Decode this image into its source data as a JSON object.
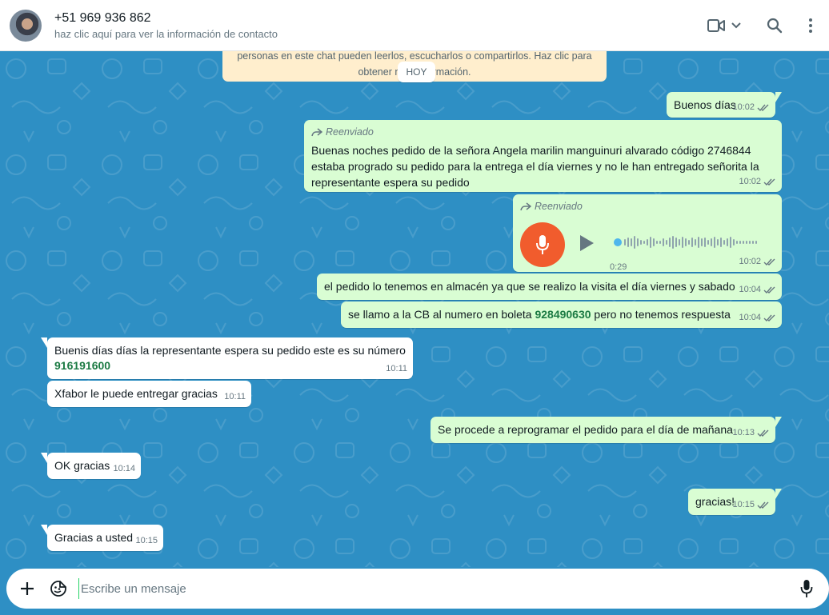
{
  "header": {
    "contact_name": "+51 969 936 862",
    "contact_subtitle": "haz clic aquí para ver la información de contacto"
  },
  "notice": {
    "line1": "personas en este chat pueden leerlos, escucharlos o compartirlos. Haz clic para",
    "line2": "obtener más información."
  },
  "date_divider": "HOY",
  "messages": [
    {
      "dir": "out",
      "text": "Buenos días",
      "time": "10:02"
    },
    {
      "dir": "out",
      "forwarded": "Reenviado",
      "text": "Buenas noches pedido de la señora Angela  marilin manguinuri alvarado  código 2746844 estaba progrado su pedido para la entrega el día viernes y no le han entregado señorita la representante espera su pedido",
      "time": "10:02"
    },
    {
      "dir": "out",
      "forwarded": "Reenviado",
      "type": "audio",
      "duration": "0:29",
      "time": "10:02"
    },
    {
      "dir": "out",
      "text": "el pedido lo tenemos en almacén ya que se realizo la visita el día viernes y sabado",
      "time": "10:04"
    },
    {
      "dir": "out",
      "text_before": "se llamo a la CB al numero en boleta ",
      "phone": "928490630",
      "text_after": " pero no tenemos respuesta",
      "time": "10:04"
    },
    {
      "dir": "in",
      "text": "Buenis días días la representante  espera su pedido este es su número",
      "phone": "916191600",
      "time": "10:11"
    },
    {
      "dir": "in",
      "text": "Xfabor le puede entregar gracias",
      "time": "10:11"
    },
    {
      "dir": "out",
      "text": "Se procede a reprogramar el pedido para el día de mañana",
      "time": "10:13"
    },
    {
      "dir": "in",
      "text": "OK gracias",
      "time": "10:14"
    },
    {
      "dir": "out",
      "text": "gracias!",
      "time": "10:15"
    },
    {
      "dir": "in",
      "text": "Gracias a usted",
      "time": "10:15"
    }
  ],
  "composer": {
    "placeholder": "Escribe un mensaje",
    "value": ""
  },
  "colors": {
    "outgoing_bubble": "#d9fdd3",
    "incoming_bubble": "#ffffff",
    "chat_background": "#2e8fc4",
    "read_ticks": "#53bdeb",
    "voice_note_mic": "#f15c2d"
  }
}
